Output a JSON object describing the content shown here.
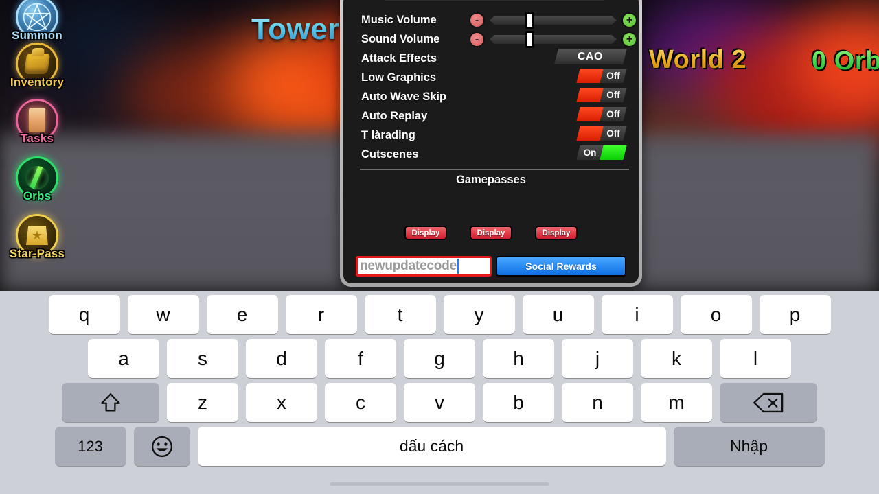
{
  "scene": {
    "title_fragment": "Tower",
    "world_label": "World 2",
    "orbs_counter": "0 Orb",
    "sidebar": [
      {
        "label": "Summon",
        "icon": "pentagram-icon",
        "key": "summon"
      },
      {
        "label": "Inventory",
        "icon": "backpack-icon",
        "key": "inventory"
      },
      {
        "label": "Tasks",
        "icon": "scroll-icon",
        "key": "tasks"
      },
      {
        "label": "Orbs",
        "icon": "orb-icon",
        "key": "orbs"
      },
      {
        "label": "Star-Pass",
        "icon": "star-badge-icon",
        "key": "star-pass"
      }
    ]
  },
  "settings": {
    "sliders": [
      {
        "label": "Music Volume",
        "minus": "-",
        "plus": "+",
        "value_percent": 35
      },
      {
        "label": "Sound Volume",
        "minus": "-",
        "plus": "+",
        "value_percent": 35
      }
    ],
    "picker": {
      "label": "Attack Effects",
      "value": "CAO"
    },
    "toggles": [
      {
        "label": "Low Graphics",
        "state": "Off"
      },
      {
        "label": "Auto Wave Skip",
        "state": "Off"
      },
      {
        "label": "Auto Replay",
        "state": "Off"
      },
      {
        "label": "T làrading",
        "state": "Off"
      },
      {
        "label": "Cutscenes",
        "state": "On"
      }
    ],
    "gamepasses_heading": "Gamepasses",
    "display_buttons": [
      "Display",
      "Display",
      "Display"
    ],
    "code_input": {
      "value": "newupdatecode",
      "placeholder": "newupdatecode"
    },
    "social_rewards_label": "Social Rewards"
  },
  "keyboard": {
    "row1": [
      "q",
      "w",
      "e",
      "r",
      "t",
      "y",
      "u",
      "i",
      "o",
      "p"
    ],
    "row2": [
      "a",
      "s",
      "d",
      "f",
      "g",
      "h",
      "j",
      "k",
      "l"
    ],
    "row3_letters": [
      "z",
      "x",
      "c",
      "v",
      "b",
      "n",
      "m"
    ],
    "shift_icon": "shift-arrow-icon",
    "backspace_icon": "backspace-icon",
    "numeric_label": "123",
    "emoji_icon": "emoji-smiley-icon",
    "space_label": "dấu cách",
    "enter_label": "Nhập"
  },
  "colors": {
    "accent_red": "#e61a1a",
    "accent_blue": "#2e8ef5",
    "toggle_off": "#ff4a22",
    "toggle_on": "#3dfb2c",
    "keyboard_bg": "#cdd0d6",
    "key_white": "#ffffff",
    "key_gray": "#a9adb7",
    "panel_bg": "#1b1b1b"
  }
}
